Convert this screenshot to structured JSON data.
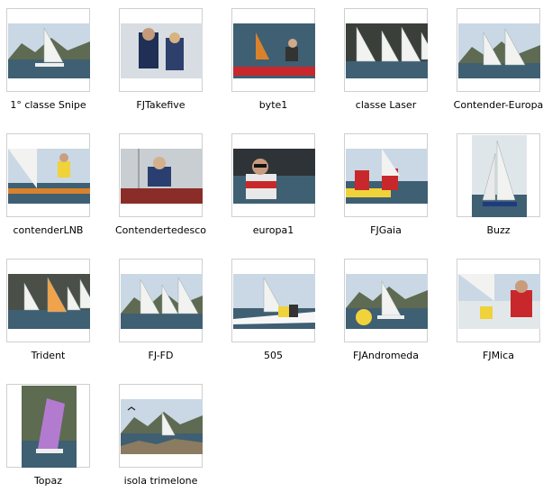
{
  "items": [
    {
      "label": "1° classe Snipe",
      "orientation": "land",
      "scene": "sail-white",
      "icon": "sailboat-photo-icon"
    },
    {
      "label": "FJTakefive",
      "orientation": "land",
      "scene": "crew-closeup",
      "icon": "sailors-photo-icon"
    },
    {
      "label": "byte1",
      "orientation": "land",
      "scene": "red-hull",
      "icon": "dinghy-photo-icon"
    },
    {
      "label": "classe Laser",
      "orientation": "land",
      "scene": "many-sails",
      "icon": "laser-fleet-photo-icon"
    },
    {
      "label": "Contender-Europa",
      "orientation": "land",
      "scene": "two-sails-mountain",
      "icon": "regatta-photo-icon"
    },
    {
      "label": "contenderLNB",
      "orientation": "land",
      "scene": "trapeze",
      "icon": "contender-photo-icon"
    },
    {
      "label": "Contendertedesco",
      "orientation": "land",
      "scene": "sailor-hull",
      "icon": "contender-sailor-photo-icon"
    },
    {
      "label": "europa1",
      "orientation": "land",
      "scene": "woman-sunglasses",
      "icon": "europa-sailor-photo-icon"
    },
    {
      "label": "FJGaia",
      "orientation": "land",
      "scene": "red-jackets",
      "icon": "fj-crew-photo-icon"
    },
    {
      "label": "Buzz",
      "orientation": "port",
      "scene": "tall-sail",
      "icon": "buzz-photo-icon"
    },
    {
      "label": "Trident",
      "orientation": "land",
      "scene": "fleet-colorful",
      "icon": "trident-photo-icon"
    },
    {
      "label": "FJ-FD",
      "orientation": "land",
      "scene": "fleet-white",
      "icon": "fj-fd-photo-icon"
    },
    {
      "label": "505",
      "orientation": "land",
      "scene": "white-hull-spi",
      "icon": "505-photo-icon"
    },
    {
      "label": "FJAndromeda",
      "orientation": "land",
      "scene": "yellow-buoy",
      "icon": "fj-andromeda-photo-icon"
    },
    {
      "label": "FJMica",
      "orientation": "land",
      "scene": "red-jackets-near",
      "icon": "fj-mica-photo-icon"
    },
    {
      "label": "Topaz",
      "orientation": "port",
      "scene": "purple-sail",
      "icon": "topaz-photo-icon"
    },
    {
      "label": "isola trimelone",
      "orientation": "land",
      "scene": "island-rocks",
      "icon": "island-photo-icon"
    }
  ],
  "colors": {
    "water": "#3f5f73",
    "sky": "#c9d8e4",
    "mountain": "#5e6a52",
    "sail": "#f2f2f0",
    "red": "#c8282b",
    "hull_orange": "#d9822b",
    "purple": "#b27bd0",
    "yellow": "#f0d23a"
  }
}
